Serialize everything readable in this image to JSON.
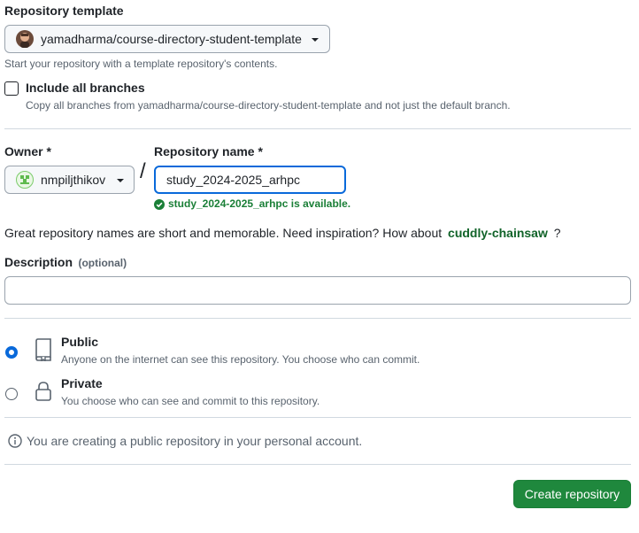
{
  "template": {
    "label": "Repository template",
    "selected": "yamadharma/course-directory-student-template",
    "help": "Start your repository with a template repository's contents.",
    "include_branches_label": "Include all branches",
    "include_branches_note": "Copy all branches from yamadharma/course-directory-student-template and not just the default branch.",
    "include_branches_checked": false
  },
  "owner": {
    "label": "Owner *",
    "selected": "nmpiljthikov"
  },
  "separator": "/",
  "repo_name": {
    "label": "Repository name *",
    "value": "study_2024-2025_arhpc",
    "availability": "study_2024-2025_arhpc is available."
  },
  "inspiration": {
    "text": "Great repository names are short and memorable. Need inspiration? How about",
    "suggestion": "cuddly-chainsaw",
    "suffix": "?"
  },
  "description": {
    "label": "Description",
    "optional": "(optional)",
    "value": ""
  },
  "visibility": {
    "public": {
      "label": "Public",
      "note": "Anyone on the internet can see this repository. You choose who can commit.",
      "checked": true
    },
    "private": {
      "label": "Private",
      "note": "You choose who can see and commit to this repository.",
      "checked": false
    }
  },
  "info_message": "You are creating a public repository in your personal account.",
  "create_button": "Create repository",
  "colors": {
    "accent_blue": "#0969da",
    "success_green": "#1a7f37",
    "button_green": "#1f883d",
    "suggestion_green": "#116329"
  }
}
